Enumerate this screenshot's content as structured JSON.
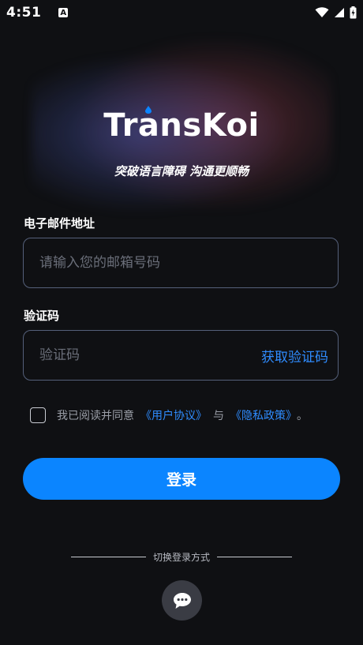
{
  "status_bar": {
    "time": "4:51",
    "notification_glyph": "A"
  },
  "brand": {
    "logo_text": "TransKoi",
    "tagline": "突破语言障碍 沟通更顺畅",
    "accent_color": "#0b85ff"
  },
  "email": {
    "label": "电子邮件地址",
    "placeholder": "请输入您的邮箱号码",
    "value": ""
  },
  "code": {
    "label": "验证码",
    "placeholder": "验证码",
    "value": "",
    "get_code_label": "获取验证码"
  },
  "agreement": {
    "checked": false,
    "prefix": "我已阅读并同意",
    "user_agreement": "《用户协议》",
    "and": "与",
    "privacy_policy": "《隐私政策》",
    "suffix": "。"
  },
  "login_button": "登录",
  "switch_login": {
    "label": "切换登录方式",
    "option_icon": "chat-bubble-icon"
  }
}
